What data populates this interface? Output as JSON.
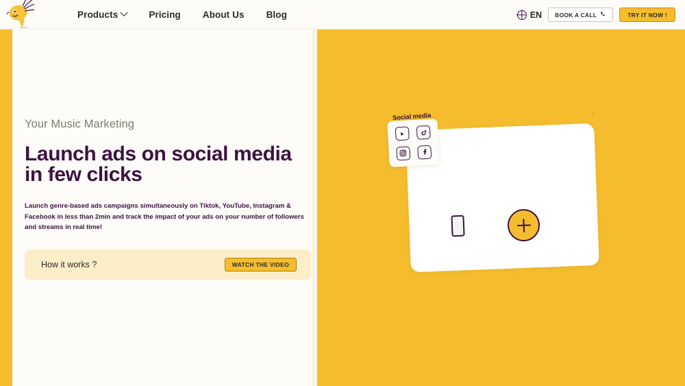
{
  "brand": {
    "logo_icon": "mascot-bird-logo"
  },
  "header": {
    "nav": [
      {
        "label": "Products",
        "has_dropdown": true,
        "icon": "chevron-down-icon"
      },
      {
        "label": "Pricing",
        "has_dropdown": false
      },
      {
        "label": "About Us",
        "has_dropdown": false
      },
      {
        "label": "Blog",
        "has_dropdown": false
      }
    ],
    "language": {
      "label": "EN",
      "icon": "globe-icon"
    },
    "book_call_button": {
      "label": "BOOK A CALL",
      "icon": "phone-icon"
    },
    "try_now_button": {
      "label": "TRY IT NOW !"
    }
  },
  "hero": {
    "eyebrow": "Your Music Marketing",
    "headline": "Launch ads on social media in few clicks",
    "subtext": "Launch genre-based ads campaigns simultaneously on Tiktok, YouTube, Instagram & Facebook in less than 2min and track the impact of your ads on your number of followers and streams in real time!",
    "cta": {
      "label": "How it works ?",
      "button_label": "WATCH THE VIDEO"
    }
  },
  "illustration": {
    "social_label": "Social media",
    "social_icons": [
      {
        "name": "youtube-icon"
      },
      {
        "name": "tiktok-icon"
      },
      {
        "name": "instagram-icon"
      },
      {
        "name": "facebook-icon"
      }
    ],
    "canvas_phone_icon": "phone-outline-icon",
    "add_button_icon": "plus-icon"
  },
  "colors": {
    "accent_yellow": "#F5BC2E",
    "dark_purple": "#3D1240",
    "off_white": "#FDFCF8",
    "cta_box": "#FBEDC8",
    "muted_text": "#7F7B72"
  }
}
